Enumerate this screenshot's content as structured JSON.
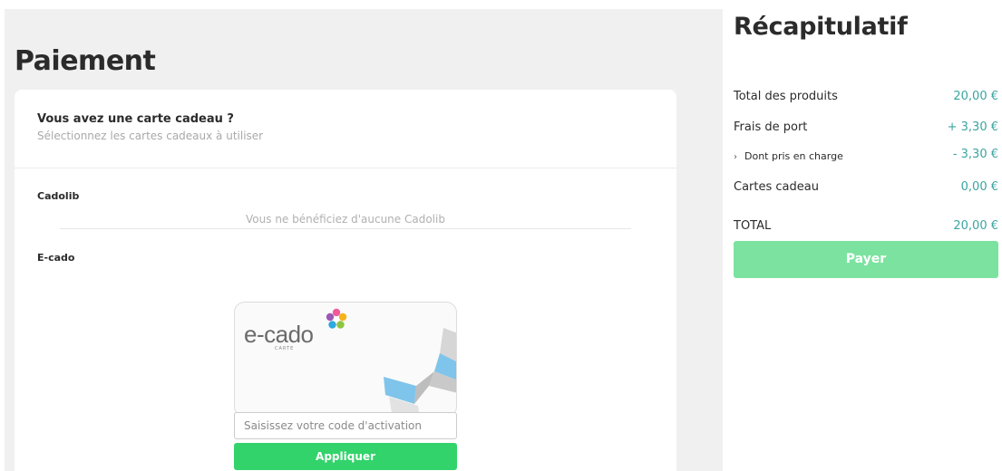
{
  "payment": {
    "title": "Paiement",
    "gift_card": {
      "heading": "Vous avez une carte cadeau ?",
      "subheading": "Sélectionnez les cartes cadeaux à utiliser"
    },
    "cadolib": {
      "label": "Cadolib",
      "empty_message": "Vous ne bénéficiez d'aucune Cadolib"
    },
    "ecado": {
      "label": "E-cado",
      "logo_text": "e-cado",
      "logo_subtext": "CARTE",
      "code_placeholder": "Saisissez votre code d'activation",
      "code_value": "",
      "apply_label": "Appliquer"
    }
  },
  "summary": {
    "title": "Récapitulatif",
    "rows": [
      {
        "label": "Total des produits",
        "value": "20,00 €"
      },
      {
        "label": "Frais de port",
        "value": "+ 3,30 €"
      },
      {
        "chevron": "›",
        "label": "Dont pris en charge",
        "value": "- 3,30 €"
      },
      {
        "label": "Cartes cadeau",
        "value": "0,00 €"
      },
      {
        "label": "TOTAL",
        "value": "20,00 €"
      }
    ],
    "pay_label": "Payer"
  },
  "colors": {
    "accent_value": "#3aa5a0",
    "apply_button": "#32d36b",
    "pay_button": "#7be39f",
    "panel_background": "#f0f0f0"
  },
  "icons": {
    "logo": "e-cado-flower-logo",
    "chevron": "chevron-right-icon",
    "ribbon": "ribbon-decoration"
  }
}
